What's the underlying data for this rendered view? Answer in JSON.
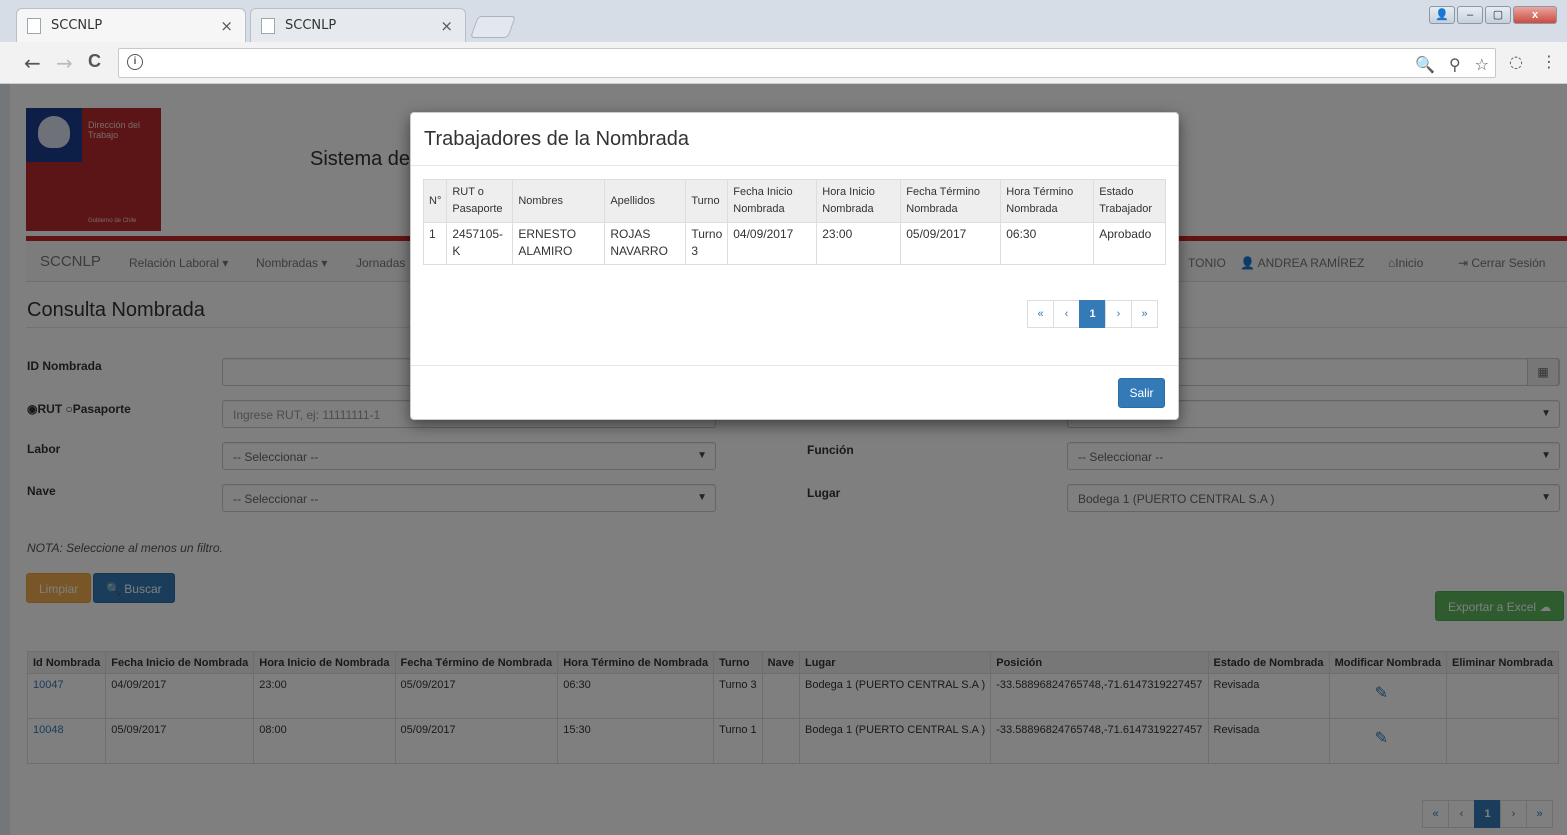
{
  "browser": {
    "tabs": [
      {
        "title": "SCCNLP"
      },
      {
        "title": "SCCNLP"
      }
    ],
    "tab_close": "×",
    "icons": {
      "back": "←",
      "forward": "→",
      "reload": "C",
      "info": "i",
      "zoom": "🔍",
      "pin": "⚲",
      "star": "☆",
      "ext": "◌",
      "menu": "⋮"
    },
    "window_controls": {
      "user": "👤",
      "minimize": "–",
      "maximize": "▢",
      "close": "x"
    }
  },
  "logo": {
    "line1": "Dirección del Trabajo",
    "line2": "Gobierno de Chile"
  },
  "site_title": "Sistema de",
  "navbar": {
    "brand": "SCCNLP",
    "items": [
      "Relación Laboral ▾",
      "Nombradas ▾",
      "Jornadas"
    ],
    "right": {
      "partial": "TONIO",
      "user": "ANDREA RAMÍREZ",
      "home": "Inicio",
      "logout": "Cerrar Sesión"
    }
  },
  "page_title": "Consulta Nombrada",
  "form": {
    "id_label": "ID Nombrada",
    "rut_label": "RUT",
    "pasaporte_label": "Pasaporte",
    "rut_placeholder": "Ingrese RUT, ej: 11111111-1",
    "labor_label": "Labor",
    "labor_value": "-- Seleccionar --",
    "funcion_label": "Función",
    "funcion_value": "-- Seleccionar --",
    "nave_label": "Nave",
    "nave_value": "-- Seleccionar --",
    "lugar_label": "Lugar",
    "lugar_value": "Bodega 1 (PUERTO CENTRAL S.A )",
    "note": "NOTA: Seleccione al menos un filtro.",
    "btn_limpiar": "Limpiar",
    "btn_buscar": "Buscar",
    "btn_exportar": "Exportar a Excel"
  },
  "main_table": {
    "headers": [
      "Id Nombrada",
      "Fecha Inicio de Nombrada",
      "Hora Inicio de Nombrada",
      "Fecha Término de Nombrada",
      "Hora Término de Nombrada",
      "Turno",
      "Nave",
      "Lugar",
      "Posición",
      "Estado de Nombrada",
      "Modificar Nombrada",
      "Eliminar Nombrada"
    ],
    "rows": [
      [
        "10047",
        "04/09/2017",
        "23:00",
        "05/09/2017",
        "06:30",
        "Turno 3",
        "",
        "Bodega 1 (PUERTO CENTRAL S.A )",
        "-33.58896824765748,-71.6147319227457",
        "Revisada"
      ],
      [
        "10048",
        "05/09/2017",
        "08:00",
        "05/09/2017",
        "15:30",
        "Turno 1",
        "",
        "Bodega 1 (PUERTO CENTRAL S.A )",
        "-33.58896824765748,-71.6147319227457",
        "Revisada"
      ]
    ]
  },
  "pagination": {
    "first": "«",
    "prev": "‹",
    "current": "1",
    "next": "›",
    "last": "»"
  },
  "modal": {
    "title": "Trabajadores de la Nombrada",
    "headers": [
      "N°",
      "RUT o Pasaporte",
      "Nombres",
      "Apellidos",
      "Turno",
      "Fecha Inicio Nombrada",
      "Hora Inicio Nombrada",
      "Fecha Término Nombrada",
      "Hora Término Nombrada",
      "Estado Trabajador"
    ],
    "rows": [
      [
        "1",
        "2457105-K",
        "ERNESTO ALAMIRO",
        "ROJAS NAVARRO",
        "Turno 3",
        "04/09/2017",
        "23:00",
        "05/09/2017",
        "06:30",
        "Aprobado"
      ]
    ],
    "btn_salir": "Salir"
  },
  "colors": {
    "primary": "#337ab7",
    "warning": "#f0ad4e",
    "success": "#5cb85c",
    "brand_red": "#c5292a",
    "brand_blue": "#1c3f8f"
  }
}
